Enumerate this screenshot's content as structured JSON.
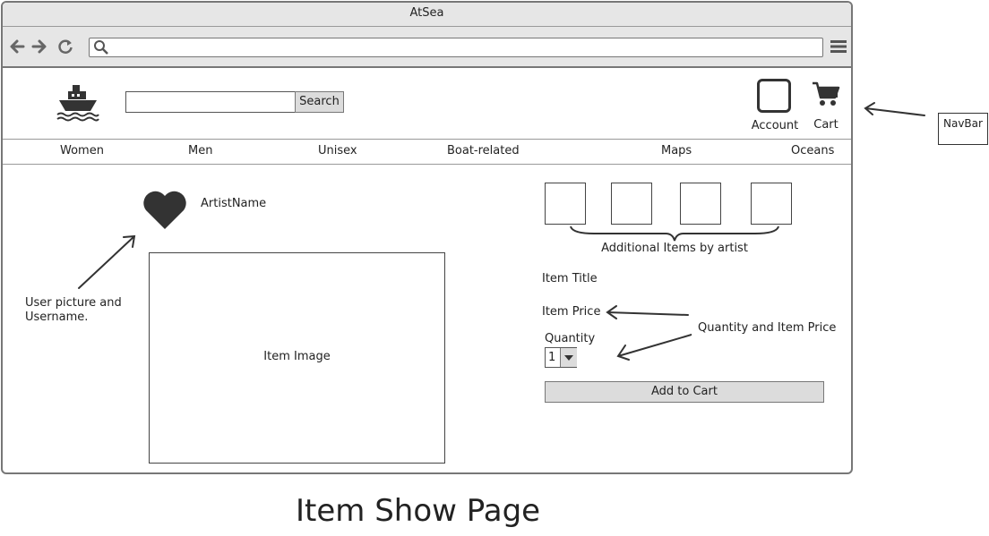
{
  "browser": {
    "title": "AtSea"
  },
  "header": {
    "search_button": "Search",
    "account_label": "Account",
    "cart_label": "Cart"
  },
  "nav": {
    "items": [
      "Women",
      "Men",
      "Unisex",
      "Boat-related",
      "Maps",
      "Oceans"
    ]
  },
  "artist": {
    "name": "ArtistName"
  },
  "item": {
    "image_label": "Item Image",
    "additional_label": "Additional Items by artist",
    "title": "Item Title",
    "price": "Item Price",
    "quantity_label": "Quantity",
    "quantity_value": "1",
    "add_to_cart": "Add to Cart"
  },
  "annotations": {
    "navbar": "NavBar",
    "user_picture": "User picture and Username.",
    "quantity_price": "Quantity and Item Price"
  },
  "page_caption": "Item Show Page",
  "icons": [
    "back-arrow-icon",
    "forward-arrow-icon",
    "reload-icon",
    "search-icon",
    "hamburger-menu-icon",
    "ship-logo-icon",
    "account-icon",
    "cart-icon",
    "heart-icon",
    "dropdown-caret-icon"
  ]
}
